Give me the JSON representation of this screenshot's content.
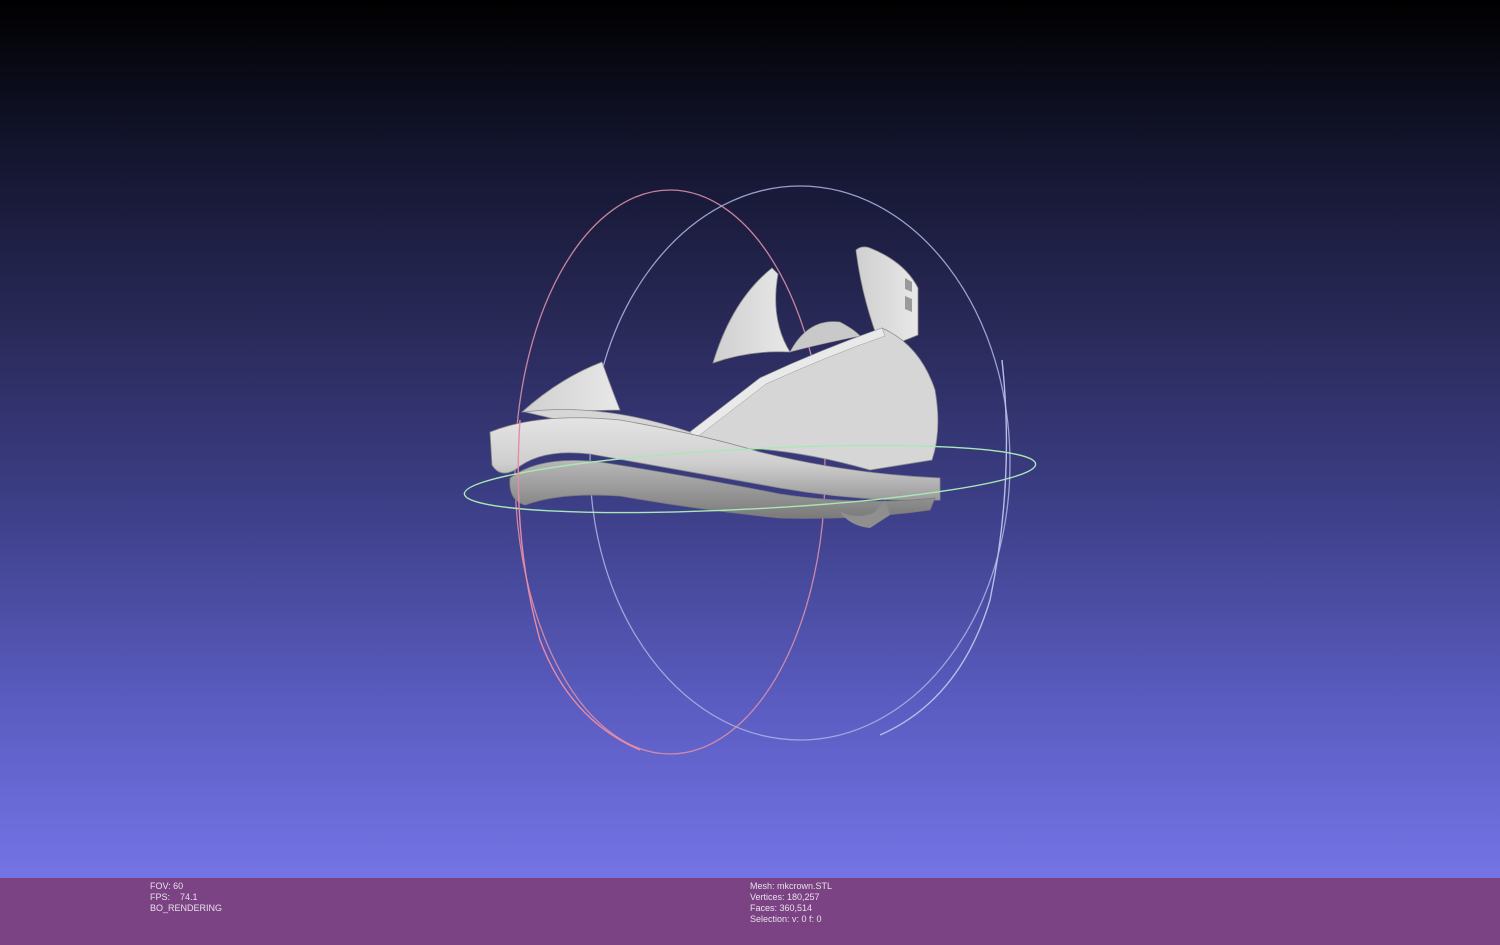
{
  "viewport": {
    "model_name": "mkcrown.STL"
  },
  "status_left": {
    "fov": "FOV: 60",
    "fps": "FPS:    74.1",
    "mode": "BO_RENDERING"
  },
  "status_right": {
    "mesh": "Mesh: mkcrown.STL",
    "vertices": "Vertices: 180,257",
    "faces": "Faces: 360,514",
    "selection": "Selection: v: 0 f: 0"
  },
  "colors": {
    "background_top": "#000000",
    "background_bottom": "#7474e6",
    "status_bar": "#7c4384",
    "mesh_fill": "#d8d8d8",
    "trackball_x": "#e58aa0",
    "trackball_y": "#9aa4e6",
    "trackball_z": "#9ee0a8"
  },
  "icons": {
    "trackball": "trackball-rings-icon"
  }
}
